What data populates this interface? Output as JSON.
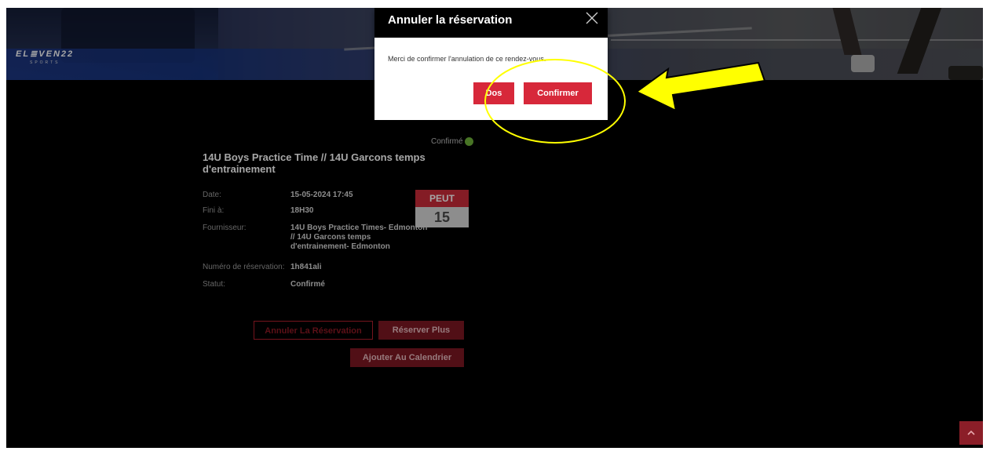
{
  "brand": {
    "logo_text": "EL≣VEN22",
    "logo_sub": "SPORTS"
  },
  "booking": {
    "status_top": "Confirmé",
    "status_color": "#6fb23a",
    "title": "14U Boys Practice Time // 14U Garcons temps d'entrainement",
    "fields": [
      {
        "label": "Date:",
        "value": "15-05-2024 17:45"
      },
      {
        "label": "Fini à:",
        "value": "18H30"
      },
      {
        "label": "Fournisseur:",
        "value": "14U Boys Practice Times- Edmonton // 14U Garcons temps d'entrainement- Edmonton"
      },
      {
        "label": "Numéro de réservation:",
        "value": "1h841ali"
      },
      {
        "label": "Statut:",
        "value": "Confirmé"
      }
    ],
    "date_badge": {
      "month": "PEUT",
      "day": "15"
    },
    "actions": {
      "cancel": "Annuler La Réservation",
      "book_more": "Réserver Plus",
      "add_calendar": "Ajouter Au Calendrier"
    }
  },
  "modal": {
    "title": "Annuler la réservation",
    "message": "Merci de confirmer l'annulation de ce rendez-vous.",
    "back_label": "Dos",
    "confirm_label": "Confirmer",
    "accent": "#d7283a"
  },
  "colors": {
    "brand_red": "#cb2c3a",
    "annotation": "#ffff00"
  },
  "icons": {
    "close": "close-icon",
    "scroll_top": "chevron-up-icon",
    "status": "status-dot-icon"
  }
}
